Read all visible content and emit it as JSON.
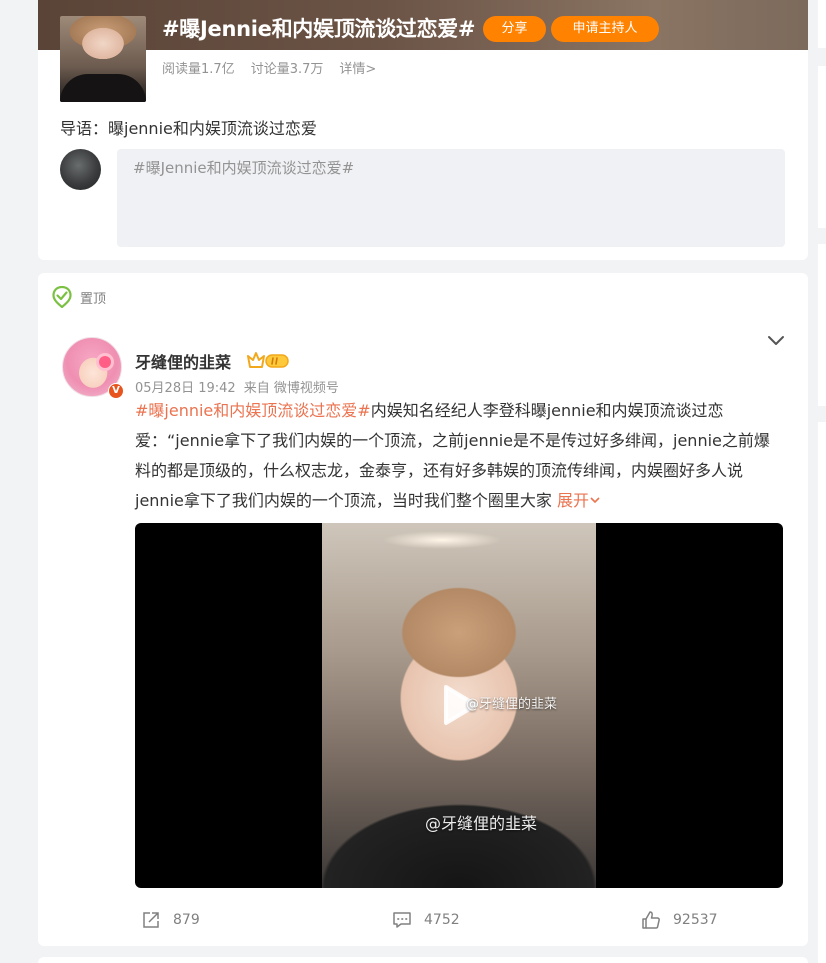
{
  "topic": {
    "title": "#曝Jennie和内娱顶流谈过恋爱#",
    "share_label": "分享",
    "host_label": "申请主持人",
    "read_count": "阅读量1.7亿",
    "discuss_count": "讨论量3.7万",
    "details_link": "详情>",
    "lead": "导语：曝jennie和内娱顶流谈过恋爱",
    "composer_text": "#曝Jennie和内娱顶流谈过恋爱#"
  },
  "post": {
    "pinned_label": "置顶",
    "author": "牙缝俚的韭菜",
    "verified_badge": "V",
    "date": "05月28日 19:42",
    "source": "来自 微博视频号",
    "hashtag": "#曝jennie和内娱顶流谈过恋爱#",
    "text": "内娱知名经纪人李登科曝jennie和内娱顶流谈过恋爱：“jennie拿下了我们内娱的一个顶流，之前jennie是不是传过好多绯闻，jennie之前爆料的都是顶级的，什么权志龙，金泰亨，还有好多韩娱的顶流传绯闻，内娱圈好多人说jennie拿下了我们内娱的一个顶流，当时我们整个圈里大家",
    "expand_label": "展开",
    "video": {
      "watermark_center": "@牙缝俚的韭菜",
      "watermark_bottom": "@牙缝俚的韭菜"
    },
    "actions": {
      "forward_count": "879",
      "comment_count": "4752",
      "like_count": "92537"
    }
  },
  "colors": {
    "accent_orange": "#ff8200",
    "link_orange": "#eb7350",
    "verified_red": "#e8541e"
  }
}
